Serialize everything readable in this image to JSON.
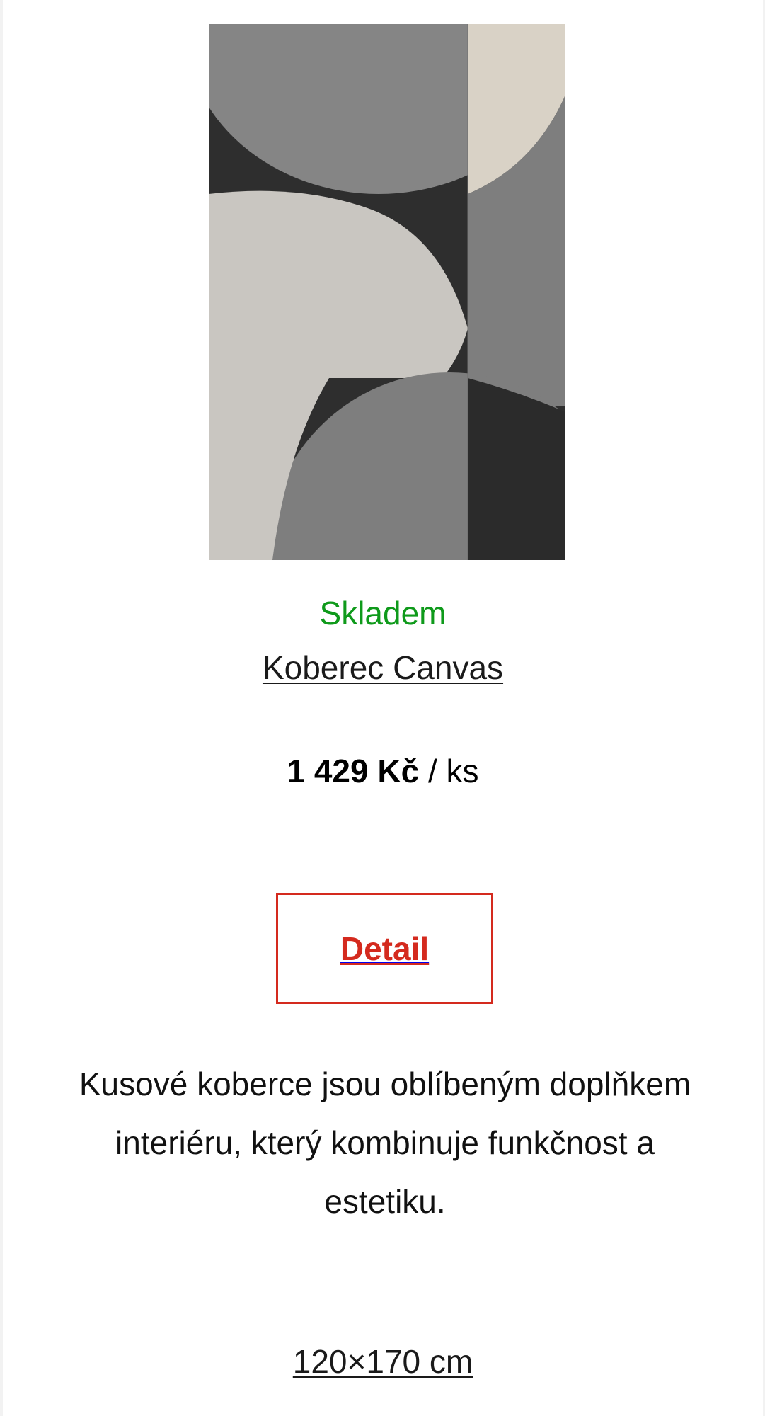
{
  "product": {
    "image_icon": "rug-image",
    "stock_status": "Skladem",
    "stock_color": "#0f9a1b",
    "name": "Koberec Canvas",
    "price_amount": "1 429 Kč",
    "price_unit": " / ks",
    "detail_label": "Detail",
    "accent_color": "#d42a1e",
    "description": "Kusové koberce jsou oblíbeným doplňkem interiéru, který kombinuje funkčnost a estetiku.",
    "size": "120×170 cm"
  }
}
